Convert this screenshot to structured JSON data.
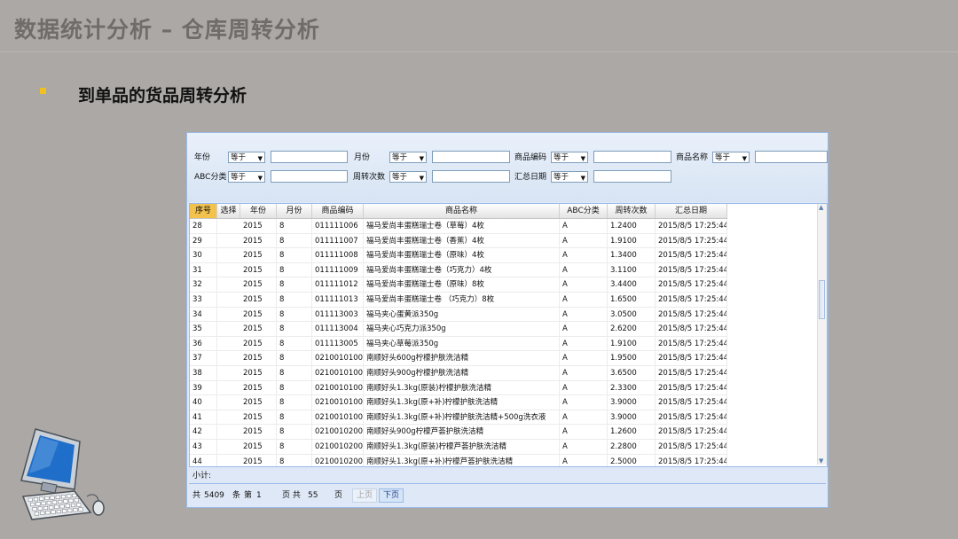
{
  "slide": {
    "title": "数据统计分析 – 仓库周转分析",
    "bullet": "到单品的货品周转分析"
  },
  "filters": {
    "year_label": "年份",
    "month_label": "月份",
    "code_label": "商品编码",
    "name_label": "商品名称",
    "abc_label": "ABC分类",
    "turnover_label": "周转次数",
    "date_label": "汇总日期",
    "operator_value": "等于"
  },
  "grid": {
    "columns": [
      "序号",
      "选择",
      "年份",
      "月份",
      "商品编码",
      "商品名称",
      "ABC分类",
      "周转次数",
      "汇总日期"
    ],
    "rows": [
      [
        "28",
        "2015",
        "8",
        "011111006",
        "福马爱尚丰蛋糕瑞士卷（草莓）4枚",
        "A",
        "1.2400",
        "2015/8/5 17:25:44"
      ],
      [
        "29",
        "2015",
        "8",
        "011111007",
        "福马爱尚丰蛋糕瑞士卷（香蕉）4枚",
        "A",
        "1.9100",
        "2015/8/5 17:25:44"
      ],
      [
        "30",
        "2015",
        "8",
        "011111008",
        "福马爱尚丰蛋糕瑞士卷（原味）4枚",
        "A",
        "1.3400",
        "2015/8/5 17:25:44"
      ],
      [
        "31",
        "2015",
        "8",
        "011111009",
        "福马爱尚丰蛋糕瑞士卷（巧克力）4枚",
        "A",
        "3.1100",
        "2015/8/5 17:25:44"
      ],
      [
        "32",
        "2015",
        "8",
        "011111012",
        "福马爱尚丰蛋糕瑞士卷（原味）8枚",
        "A",
        "3.4400",
        "2015/8/5 17:25:44"
      ],
      [
        "33",
        "2015",
        "8",
        "011111013",
        "福马爱尚丰蛋糕瑞士卷 （巧克力）8枚",
        "A",
        "1.6500",
        "2015/8/5 17:25:44"
      ],
      [
        "34",
        "2015",
        "8",
        "011113003",
        "福马夹心蛋黄派350g",
        "A",
        "3.0500",
        "2015/8/5 17:25:44"
      ],
      [
        "35",
        "2015",
        "8",
        "011113004",
        "福马夹心巧克力派350g",
        "A",
        "2.6200",
        "2015/8/5 17:25:44"
      ],
      [
        "36",
        "2015",
        "8",
        "011113005",
        "福马夹心草莓派350g",
        "A",
        "1.9100",
        "2015/8/5 17:25:44"
      ],
      [
        "37",
        "2015",
        "8",
        "02100101001",
        "南顺好头600g柠檬护肤洗洁精",
        "A",
        "1.9500",
        "2015/8/5 17:25:44"
      ],
      [
        "38",
        "2015",
        "8",
        "02100101002",
        "南顺好头900g柠檬护肤洗洁精",
        "A",
        "3.6500",
        "2015/8/5 17:25:44"
      ],
      [
        "39",
        "2015",
        "8",
        "02100101003",
        "南顺好头1.3kg(原装)柠檬护肤洗洁精",
        "A",
        "2.3300",
        "2015/8/5 17:25:44"
      ],
      [
        "40",
        "2015",
        "8",
        "02100101004",
        "南顺好头1.3kg(原+补)柠檬护肤洗洁精",
        "A",
        "3.9000",
        "2015/8/5 17:25:44"
      ],
      [
        "41",
        "2015",
        "8",
        "02100101005",
        "南顺好头1.3kg(原+补)柠檬护肤洗洁精+500g洗衣液",
        "A",
        "3.9000",
        "2015/8/5 17:25:44"
      ],
      [
        "42",
        "2015",
        "8",
        "02100102001",
        "南顺好头900g柠檬芦荟护肤洗洁精",
        "A",
        "1.2600",
        "2015/8/5 17:25:44"
      ],
      [
        "43",
        "2015",
        "8",
        "02100102002",
        "南顺好头1.3kg(原装)柠檬芦荟护肤洗洁精",
        "A",
        "2.2800",
        "2015/8/5 17:25:44"
      ],
      [
        "44",
        "2015",
        "8",
        "02100102003",
        "南顺好头1.3kg(原+补)柠檬芦荟护肤洗洁精",
        "A",
        "2.5000",
        "2015/8/5 17:25:44"
      ]
    ]
  },
  "subtotal_label": "小计:",
  "pager": {
    "total_prefix": "共",
    "total_count": "5409",
    "record_unit": "条",
    "page_prefix": "第",
    "current_page": "1",
    "pages_label": "页 共",
    "page_count": "55",
    "page_unit": "页",
    "prev_label": "上页",
    "next_label": "下页"
  },
  "colors": {
    "sorted_header": "#f3c24d",
    "bullet": "#f0c020",
    "panel": "#dfe8f6"
  },
  "icons": [
    "computer-monitor-icon",
    "keyboard-icon",
    "mouse-icon",
    "sort-icon"
  ]
}
